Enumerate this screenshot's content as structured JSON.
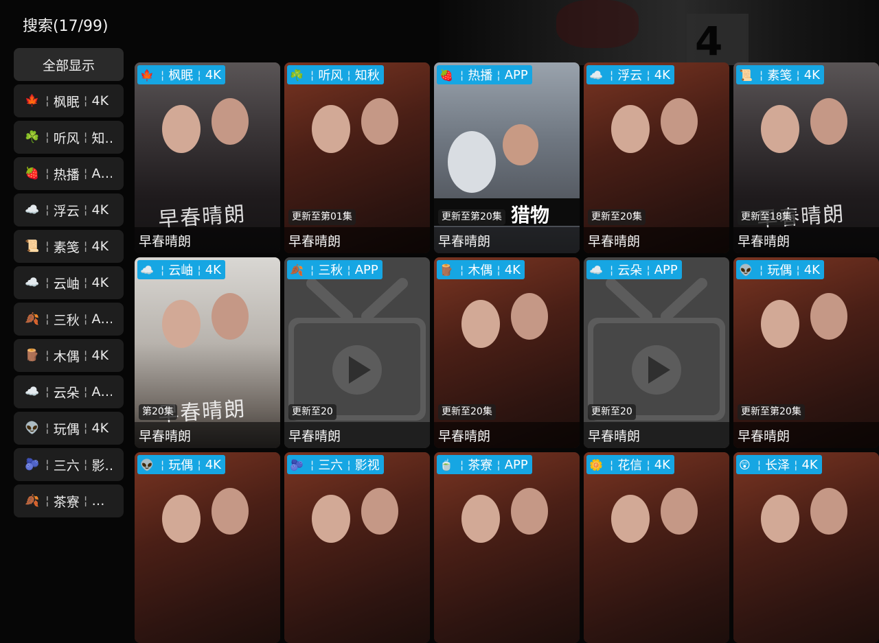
{
  "header": {
    "title": "搜索(17/99)"
  },
  "sidebar": {
    "show_all": "全部显示",
    "items": [
      {
        "emoji": "🍁",
        "name": "枫眠",
        "quality": "4K"
      },
      {
        "emoji": "☘️",
        "name": "听风",
        "quality": "知…"
      },
      {
        "emoji": "🍓",
        "name": "热播",
        "quality": "A…"
      },
      {
        "emoji": "☁️",
        "name": "浮云",
        "quality": "4K"
      },
      {
        "emoji": "📜",
        "name": "素笺",
        "quality": "4K"
      },
      {
        "emoji": "☁️",
        "name": "云岫",
        "quality": "4K"
      },
      {
        "emoji": "🍂",
        "name": "三秋",
        "quality": "A…"
      },
      {
        "emoji": "🪵",
        "name": "木偶",
        "quality": "4K"
      },
      {
        "emoji": "☁️",
        "name": "云朵",
        "quality": "A…"
      },
      {
        "emoji": "👽",
        "name": "玩偶",
        "quality": "4K"
      },
      {
        "emoji": "🫐",
        "name": "三六",
        "quality": "影…"
      },
      {
        "emoji": "🍂",
        "name": "茶寮",
        "quality": "…"
      }
    ]
  },
  "results": [
    {
      "emoji": "🍁",
      "source": "枫眠",
      "quality": "4K",
      "badge": "",
      "title": "早春晴朗"
    },
    {
      "emoji": "☘️",
      "source": "听风",
      "quality": "知秋",
      "badge": "更新至第01集",
      "title": "早春晴朗"
    },
    {
      "emoji": "🍓",
      "source": "热播",
      "quality": "APP",
      "badge": "更新至第20集",
      "title": "早春晴朗"
    },
    {
      "emoji": "☁️",
      "source": "浮云",
      "quality": "4K",
      "badge": "更新至20集",
      "title": "早春晴朗"
    },
    {
      "emoji": "📜",
      "source": "素笺",
      "quality": "4K",
      "badge": "更新至18集",
      "title": "早春晴朗"
    },
    {
      "emoji": "☁️",
      "source": "云岫",
      "quality": "4K",
      "badge": "第20集",
      "title": "早春晴朗"
    },
    {
      "emoji": "🍂",
      "source": "三秋",
      "quality": "APP",
      "badge": "更新至20",
      "title": "早春晴朗"
    },
    {
      "emoji": "🪵",
      "source": "木偶",
      "quality": "4K",
      "badge": "更新至20集",
      "title": "早春晴朗"
    },
    {
      "emoji": "☁️",
      "source": "云朵",
      "quality": "APP",
      "badge": "更新至20",
      "title": "早春晴朗"
    },
    {
      "emoji": "👽",
      "source": "玩偶",
      "quality": "4K",
      "badge": "更新至第20集",
      "title": "早春晴朗"
    },
    {
      "emoji": "👽",
      "source": "玩偶",
      "quality": "4K",
      "badge": "",
      "title": ""
    },
    {
      "emoji": "🫐",
      "source": "三六",
      "quality": "影视",
      "badge": "",
      "title": ""
    },
    {
      "emoji": "🍵",
      "source": "茶寮",
      "quality": "APP",
      "badge": "",
      "title": ""
    },
    {
      "emoji": "🌼",
      "source": "花信",
      "quality": "4K",
      "badge": "",
      "title": ""
    },
    {
      "emoji": "😲",
      "source": "长泽",
      "quality": "4K",
      "badge": "",
      "title": ""
    }
  ],
  "poster_text": {
    "calligraphy": "早春晴朗",
    "strip_text": "猎物",
    "background_banner": "4"
  },
  "colors": {
    "label_bg": "#16a6e3",
    "sidebar_item_bg": "#1e1e1e",
    "sidebar_all_bg": "#2a2a2a",
    "page_bg": "#060606"
  },
  "icons": {
    "placeholder": "tv-play-icon"
  }
}
